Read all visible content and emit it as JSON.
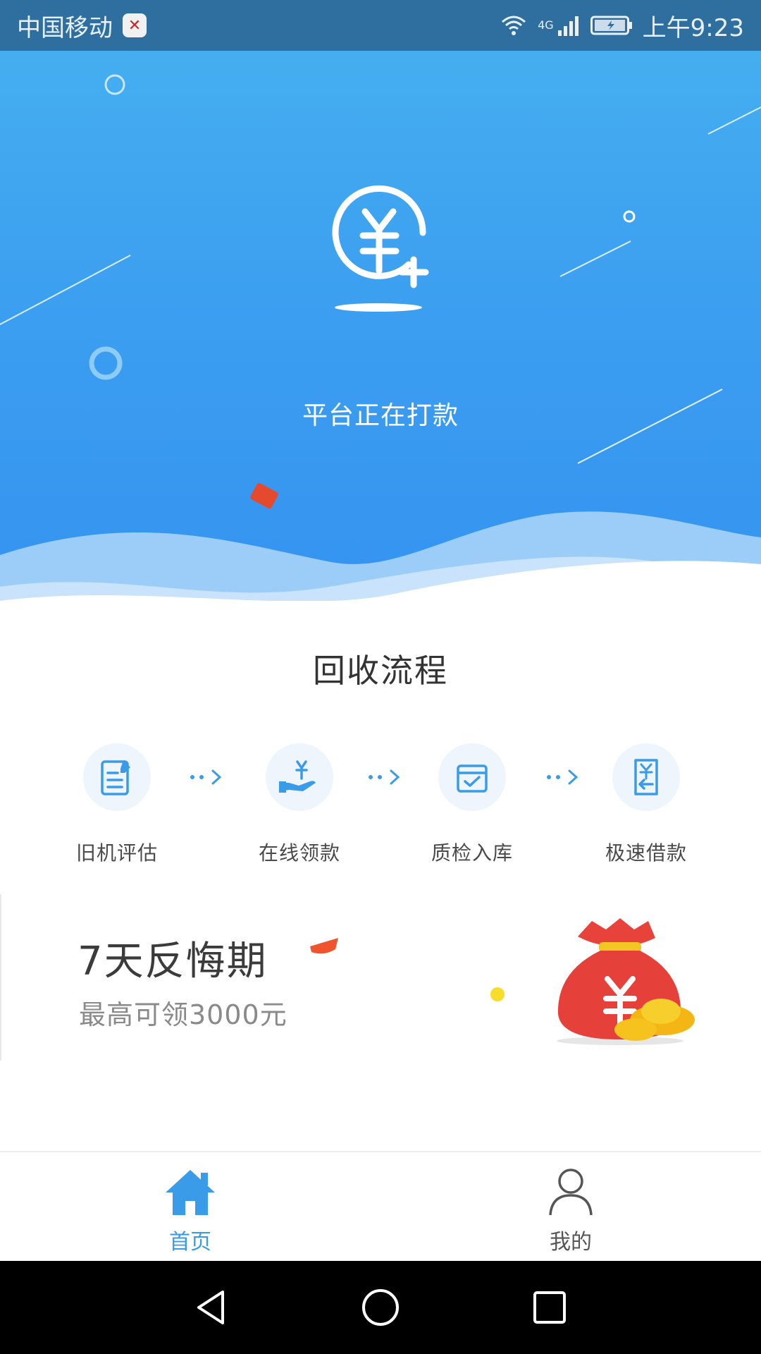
{
  "status_bar": {
    "carrier": "中国移动",
    "network": "4G",
    "time": "上午9:23"
  },
  "hero": {
    "message": "平台正在打款"
  },
  "process": {
    "title": "回收流程",
    "steps": [
      {
        "label": "旧机评估",
        "icon": "document-edit-icon"
      },
      {
        "label": "在线领款",
        "icon": "hand-money-icon"
      },
      {
        "label": "质检入库",
        "icon": "inspection-box-icon"
      },
      {
        "label": "极速借款",
        "icon": "loan-receipt-icon"
      }
    ]
  },
  "promo": {
    "title": "7天反悔期",
    "subtitle": "最高可领3000元"
  },
  "tab_bar": {
    "tabs": [
      {
        "label": "首页",
        "icon": "home-icon",
        "active": true
      },
      {
        "label": "我的",
        "icon": "user-icon",
        "active": false
      }
    ]
  },
  "colors": {
    "accent": "#3a9be8",
    "hero_top": "#45aef0",
    "hero_bottom": "#3593f0",
    "promo_bag": "#e5403a",
    "gold": "#f5c020"
  }
}
